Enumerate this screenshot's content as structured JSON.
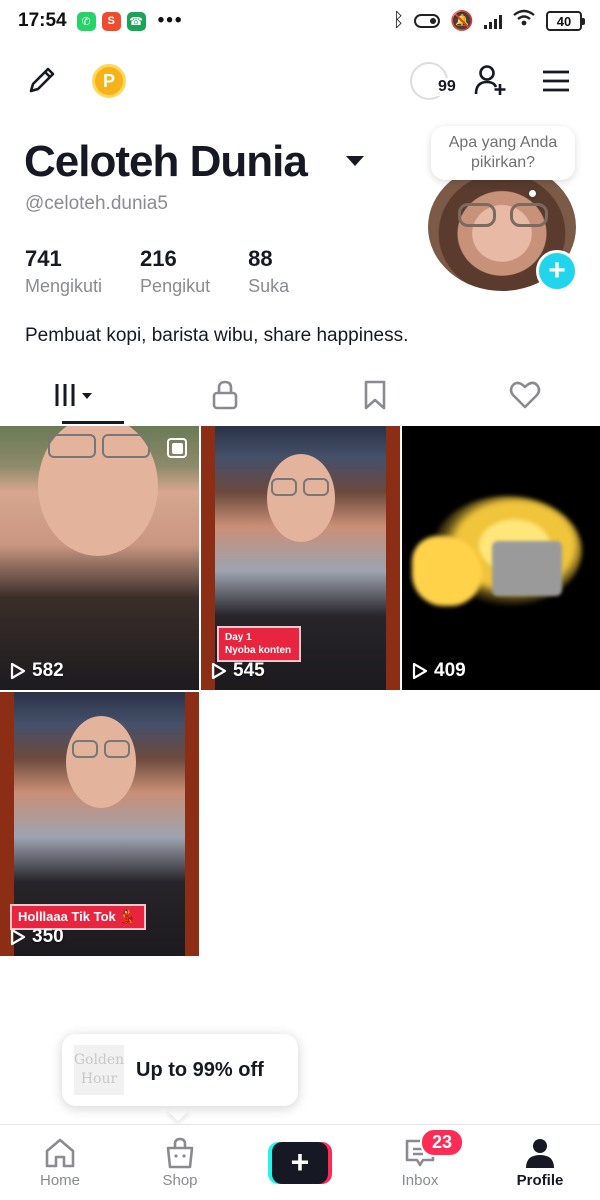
{
  "status_bar": {
    "time": "17:54",
    "more": "•••",
    "battery": "40",
    "apps": [
      "whatsapp-icon",
      "shopee-icon",
      "phone-icon"
    ]
  },
  "top_bar": {
    "story_count": "99",
    "coin_label": "P"
  },
  "profile": {
    "name": "Celoteh Dunia",
    "handle": "@celoteh.dunia5",
    "bio": "Pembuat kopi, barista wibu, share happiness.",
    "bubble_text": "Apa yang Anda pikirkan?",
    "avatar_plus": "+"
  },
  "stats": [
    {
      "value": "741",
      "label": "Mengikuti"
    },
    {
      "value": "216",
      "label": "Pengikut"
    },
    {
      "value": "88",
      "label": "Suka"
    }
  ],
  "tabs": [
    {
      "icon": "grid-icon",
      "active": true
    },
    {
      "icon": "lock-icon",
      "active": false
    },
    {
      "icon": "bookmark-icon",
      "active": false
    },
    {
      "icon": "heart-icon",
      "active": false
    }
  ],
  "videos": [
    {
      "views": "582",
      "overlay": ""
    },
    {
      "views": "545",
      "sticker_line1": "Day 1",
      "sticker_line2": "Nyoba konten"
    },
    {
      "views": "409",
      "overlay": ""
    },
    {
      "views": "350",
      "sticker": "Holllaaa Tik Tok 💃"
    }
  ],
  "promo": {
    "logo_line1": "Golden",
    "logo_line2": "Hour",
    "text": "Up to 99% off"
  },
  "bottom_nav": [
    {
      "label": "Home",
      "icon": "home-icon"
    },
    {
      "label": "Shop",
      "icon": "shop-bag-icon"
    },
    {
      "label": "",
      "icon": "create-plus-icon"
    },
    {
      "label": "Inbox",
      "icon": "inbox-icon",
      "badge": "23"
    },
    {
      "label": "Profile",
      "icon": "profile-icon",
      "active": true
    }
  ],
  "colors": {
    "accent_cyan": "#20d5ec",
    "accent_red": "#fe2c55",
    "text_primary": "#161823",
    "text_secondary": "#8a8b91"
  }
}
